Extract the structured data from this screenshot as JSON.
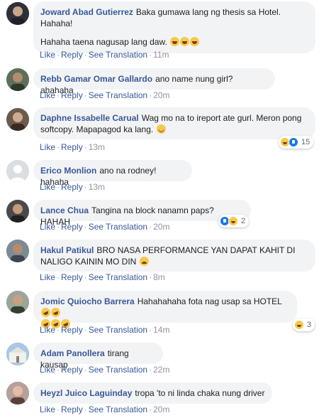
{
  "actions": {
    "like": "Like",
    "reply": "Reply",
    "see_translation": "See Translation",
    "separator": "·"
  },
  "comments": [
    {
      "name": "Joward Abad Gutierrez",
      "lines": [
        "Baka gumawa lang ng thesis sa Hotel.",
        "Hahaha!",
        "",
        "Hahaha taena nagusap lang daw."
      ],
      "trailing_emojis": [
        "laughing",
        "laughing",
        "laughing"
      ],
      "time": "11m",
      "avatar": "user-photo"
    },
    {
      "name": "Rebb Gamar Omar Gallardo",
      "lines": [
        "ano name nung girl? ahahaha"
      ],
      "time": "20m",
      "avatar": "user-photo"
    },
    {
      "name": "Daphne Issabelle Carual",
      "lines": [
        "Wag mo na to ireport ate gurl. Meron pong",
        "softcopy. Mapapagod ka lang."
      ],
      "trailing_emojis": [
        "smiling"
      ],
      "time": "13m",
      "avatar": "user-photo",
      "reactions": {
        "types": [
          "haha",
          "like"
        ],
        "count": "15"
      }
    },
    {
      "name": "Erico Monlion",
      "lines": [
        "ano na rodney! hahaha"
      ],
      "time": "13m",
      "avatar": "default-silhouette"
    },
    {
      "name": "Lance Chua",
      "lines": [
        "Tangina na block nanamn paps? HAHAH"
      ],
      "time": "20m",
      "avatar": "user-photo",
      "reactions": {
        "types": [
          "like",
          "haha"
        ],
        "count": "2"
      }
    },
    {
      "name": "Hakul Patikul",
      "lines": [
        "BRO NASA PERFORMANCE YAN DAPAT KAHIT DI",
        "NALIGO KAININ MO DIN"
      ],
      "trailing_emojis": [
        "grinning-sweat"
      ],
      "time": "8m",
      "avatar": "user-photo"
    },
    {
      "name": "Jomic Quiocho Barrera",
      "lines": [
        "Hahahahaha fota nag usap sa HOTEL"
      ],
      "trailing_emojis": [
        "rofl",
        "rofl"
      ],
      "second_line_emojis": [
        "rofl",
        "rofl",
        "rofl"
      ],
      "time": "14m",
      "avatar": "user-photo",
      "reactions": {
        "types": [
          "haha"
        ],
        "count": "3"
      }
    },
    {
      "name": "Adam Panollera",
      "lines": [
        "tirang kausap"
      ],
      "time": "22m",
      "avatar": "building-photo"
    },
    {
      "name": "Heyzl Juico Laguinday",
      "lines": [
        "tropa 'to ni linda chaka nung driver"
      ],
      "time": "20m",
      "avatar": "user-photo"
    }
  ],
  "colors": {
    "name_link": "#385898",
    "bubble_bg": "#f2f3f5",
    "meta_gray": "#90949c"
  }
}
